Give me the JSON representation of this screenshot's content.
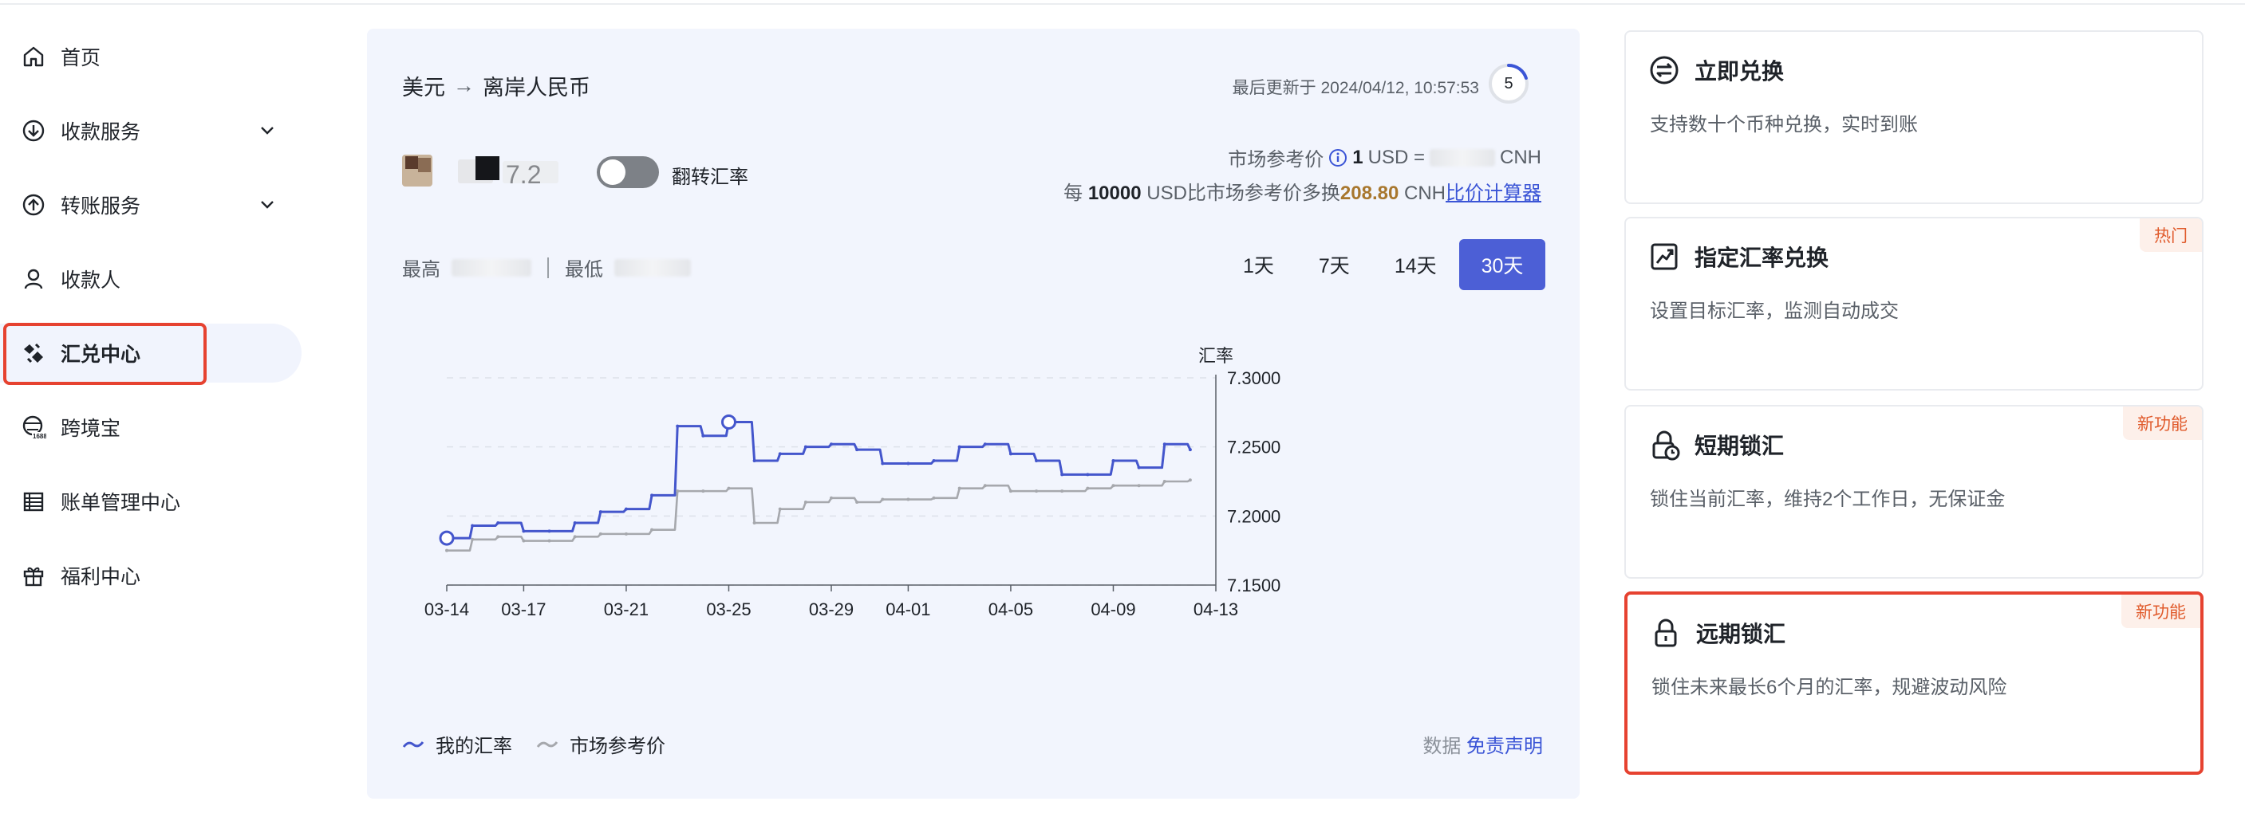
{
  "sidebar": {
    "items": [
      {
        "label": "首页",
        "icon": "home-icon"
      },
      {
        "label": "收款服务",
        "icon": "receive-icon",
        "expandable": true
      },
      {
        "label": "转账服务",
        "icon": "transfer-icon",
        "expandable": true
      },
      {
        "label": "收款人",
        "icon": "payee-icon"
      },
      {
        "label": "汇兑中心",
        "icon": "exchange-center-icon",
        "active": true
      },
      {
        "label": "跨境宝",
        "icon": "cross-border-icon"
      },
      {
        "label": "账单管理中心",
        "icon": "bill-icon"
      },
      {
        "label": "福利中心",
        "icon": "gift-icon"
      }
    ]
  },
  "main": {
    "pair_from": "美元",
    "pair_arrow": "→",
    "pair_to": "离岸人民币",
    "last_updated_label": "最后更新于 2024/04/12, 10:57:53",
    "refresh_countdown": "5",
    "refresh_progress": 0.2,
    "toggle_label": "翻转汇率",
    "toggle_on": false,
    "ref_price_label": "市场参考价",
    "ref_price_amount": "1",
    "ref_price_from": "USD =",
    "ref_price_to": "CNH",
    "compare_prefix": "每",
    "compare_amount": "10000",
    "compare_mid": "USD比市场参考价多换",
    "compare_gain": "208.80",
    "compare_unit": "CNH",
    "calculator_link": "比价计算器",
    "high_label": "最高",
    "low_label": "最低",
    "ranges": [
      "1天",
      "7天",
      "14天",
      "30天"
    ],
    "active_range": "30天",
    "legend_mine": "我的汇率",
    "legend_market": "市场参考价",
    "disclaimer_prefix": "数据",
    "disclaimer_link": "免责声明"
  },
  "chart_data": {
    "type": "line",
    "ylabel": "汇率",
    "ylim": [
      7.15,
      7.3
    ],
    "yticks": [
      "7.3000",
      "7.2500",
      "7.2000",
      "7.1500"
    ],
    "xticks": [
      "03-14",
      "03-17",
      "03-21",
      "03-25",
      "03-29",
      "04-01",
      "04-05",
      "04-09",
      "04-13"
    ],
    "x": [
      "03-14",
      "03-15",
      "03-16",
      "03-17",
      "03-18",
      "03-19",
      "03-20",
      "03-21",
      "03-22",
      "03-23",
      "03-24",
      "03-25",
      "03-26",
      "03-27",
      "03-28",
      "03-29",
      "03-30",
      "03-31",
      "04-01",
      "04-02",
      "04-03",
      "04-04",
      "04-05",
      "04-06",
      "04-07",
      "04-08",
      "04-09",
      "04-10",
      "04-11",
      "04-12"
    ],
    "series": [
      {
        "name": "我的汇率",
        "color": "#4456cc",
        "values": [
          7.184,
          7.193,
          7.195,
          7.189,
          7.189,
          7.195,
          7.203,
          7.205,
          7.215,
          7.265,
          7.258,
          7.268,
          7.24,
          7.245,
          7.25,
          7.252,
          7.248,
          7.238,
          7.238,
          7.24,
          7.25,
          7.252,
          7.245,
          7.24,
          7.23,
          7.23,
          7.24,
          7.235,
          7.252,
          7.248
        ]
      },
      {
        "name": "市场参考价",
        "color": "#a6a8ad",
        "values": [
          7.175,
          7.183,
          7.185,
          7.182,
          7.182,
          7.185,
          7.187,
          7.187,
          7.19,
          7.218,
          7.218,
          7.22,
          7.195,
          7.205,
          7.21,
          7.213,
          7.21,
          7.212,
          7.212,
          7.213,
          7.22,
          7.222,
          7.218,
          7.218,
          7.218,
          7.22,
          7.222,
          7.222,
          7.225,
          7.226
        ]
      }
    ],
    "grid": "horizontal-dashed",
    "legend": "bottom-left"
  },
  "cards": [
    {
      "title": "立即兑换",
      "desc": "支持数十个币种兑换，实时到账",
      "icon": "exchange-now-icon",
      "tag": ""
    },
    {
      "title": "指定汇率兑换",
      "desc": "设置目标汇率，监测自动成交",
      "icon": "target-rate-icon",
      "tag": "热门"
    },
    {
      "title": "短期锁汇",
      "desc": "锁住当前汇率，维持2个工作日，无保证金",
      "icon": "short-lock-icon",
      "tag": "新功能"
    },
    {
      "title": "远期锁汇",
      "desc": "锁住未来最长6个月的汇率，规避波动风险",
      "icon": "forward-lock-icon",
      "tag": "新功能"
    }
  ],
  "colors": {
    "accent": "#4c5fd6",
    "highlight": "#e64230",
    "gain": "#a8772e"
  }
}
